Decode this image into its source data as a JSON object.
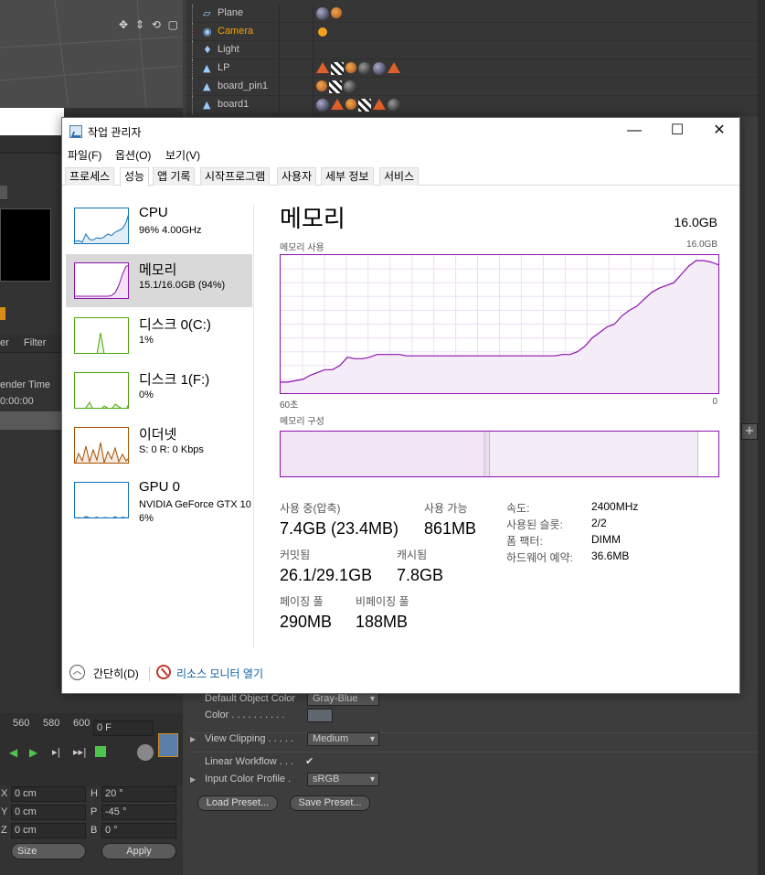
{
  "c4d": {
    "objects": [
      {
        "name": "Plane",
        "color": "#c8c8c8"
      },
      {
        "name": "Camera",
        "color": "#f5a000"
      },
      {
        "name": "Light",
        "color": "#c8c8c8"
      },
      {
        "name": "LP",
        "color": "#c8c8c8"
      },
      {
        "name": "board_pin1",
        "color": "#c8c8c8"
      },
      {
        "name": "board1",
        "color": "#c8c8c8"
      }
    ],
    "left_strip": {
      "col1": "er",
      "col2": "Filter",
      "render_time_label": "ender Time",
      "render_time_value": "0:00:00"
    },
    "timeline": {
      "ticks": [
        "560",
        "580",
        "600"
      ],
      "frame_value": "0 F"
    },
    "coords": {
      "x_label": "X",
      "x_value": "0 cm",
      "h_label": "H",
      "h_value": "20 °",
      "y_label": "Y",
      "y_value": "0 cm",
      "p_label": "P",
      "p_value": "-45 °",
      "z_label": "Z",
      "z_value": "0 cm",
      "b_label": "B",
      "b_value": "0 °",
      "mode_value": "Size",
      "apply_label": "Apply"
    },
    "attributes": {
      "default_object_color_label": "Default Object Color",
      "default_object_color_value": "Gray-Blue",
      "color_label": "Color . . . . . . . . . .",
      "view_clipping_label": "View Clipping . . . . .",
      "view_clipping_value": "Medium",
      "linear_workflow_label": "Linear Workflow . . .",
      "linear_workflow_check": "✔",
      "input_color_profile_label": "Input Color Profile .",
      "input_color_profile_value": "sRGB",
      "load_preset_label": "Load Preset...",
      "save_preset_label": "Save Preset..."
    }
  },
  "taskmanager": {
    "title": "작업 관리자",
    "controls": {
      "minimize": "—",
      "maximize": "☐",
      "close": "✕"
    },
    "menus": [
      "파일(F)",
      "옵션(O)",
      "보기(V)"
    ],
    "tabs": [
      "프로세스",
      "성능",
      "앱 기록",
      "시작프로그램",
      "사용자",
      "세부 정보",
      "서비스"
    ],
    "active_tab": "성능",
    "sidebar": [
      {
        "name": "CPU",
        "sub": "96%  4.00GHz",
        "sub2": "",
        "color": "#1170b8"
      },
      {
        "name": "메모리",
        "sub": "15.1/16.0GB (94%)",
        "sub2": "",
        "color": "#8b12ae"
      },
      {
        "name": "디스크 0(C:)",
        "sub": "1%",
        "sub2": "",
        "color": "#4da60c"
      },
      {
        "name": "디스크 1(F:)",
        "sub": "0%",
        "sub2": "",
        "color": "#4da60c"
      },
      {
        "name": "이더넷",
        "sub": "S: 0  R: 0 Kbps",
        "sub2": "",
        "color": "#a74f01"
      },
      {
        "name": "GPU 0",
        "sub": "NVIDIA GeForce GTX 10",
        "sub2": "6%",
        "color": "#1170b8"
      }
    ],
    "selected_index": 1,
    "memory": {
      "title": "메모리",
      "total": "16.0GB",
      "usage_label": "메모리 사용",
      "usage_max": "16.0GB",
      "axis_left": "60초",
      "axis_right": "0",
      "composition_label": "메모리 구성",
      "history_percent": [
        8,
        8,
        9,
        10,
        13,
        15,
        17,
        17,
        20,
        26,
        25,
        25,
        26,
        28,
        28,
        28,
        28,
        27,
        27,
        27,
        27,
        27,
        27,
        27,
        27,
        27,
        27,
        27,
        27,
        27,
        27,
        27,
        27,
        27,
        27,
        27,
        27,
        27,
        28,
        28,
        30,
        34,
        40,
        44,
        48,
        50,
        56,
        60,
        63,
        68,
        73,
        76,
        78,
        80,
        86,
        92,
        96,
        96,
        95,
        93
      ],
      "composition_percent": {
        "in_use": 46.6,
        "modified": 1.2,
        "standby": 47.6,
        "free": 4.6
      },
      "stats": {
        "in_use_label": "사용 중(압축)",
        "in_use_value": "7.4GB (23.4MB)",
        "available_label": "사용 가능",
        "available_value": "861MB",
        "committed_label": "커밋됨",
        "committed_value": "26.1/29.1GB",
        "cached_label": "캐시됨",
        "cached_value": "7.8GB",
        "paged_label": "페이징 풀",
        "paged_value": "290MB",
        "nonpaged_label": "비페이징 풀",
        "nonpaged_value": "188MB"
      },
      "details": [
        {
          "label": "속도:",
          "value": "2400MHz"
        },
        {
          "label": "사용된 슬롯:",
          "value": "2/2"
        },
        {
          "label": "폼 팩터:",
          "value": "DIMM"
        },
        {
          "label": "하드웨어 예약:",
          "value": "36.6MB"
        }
      ]
    },
    "footer": {
      "collapse_label": "간단히(D)",
      "resource_monitor_label": "리소스 모니터 열기"
    }
  }
}
